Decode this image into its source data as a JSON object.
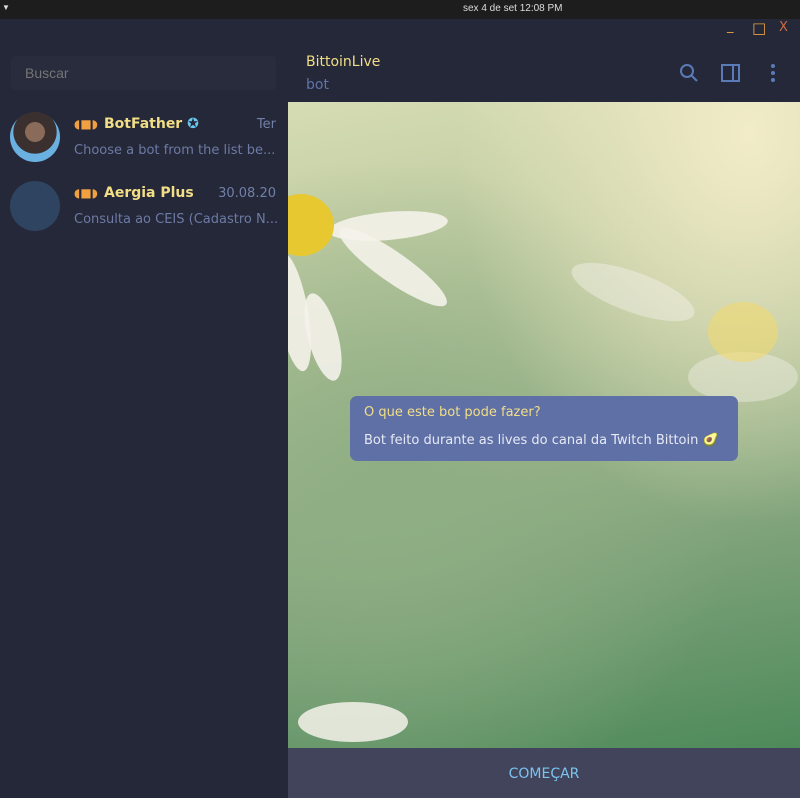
{
  "system_bar": {
    "clock": "sex 4 de set  12:08 PM"
  },
  "window_controls": {
    "minimize": "_",
    "maximize": "□",
    "close": "X"
  },
  "sidebar": {
    "search_placeholder": "Buscar",
    "chats": [
      {
        "name": "BotFather",
        "verified": true,
        "date": "Ter",
        "preview": "Choose a bot from the list be..."
      },
      {
        "name": "Aergia Plus",
        "verified": false,
        "date": "30.08.20",
        "preview": "Consulta ao CEIS (Cadastro N..."
      }
    ]
  },
  "header": {
    "title": "BittoinLive",
    "subtitle": "bot",
    "icons": [
      "search-icon",
      "sidebar-toggle-icon",
      "more-icon"
    ]
  },
  "message": {
    "title": "O que este bot pode fazer?",
    "text": "Bot feito durante as lives do canal da Twitch Bittoin",
    "emoji": "🥑"
  },
  "bottom": {
    "start_label": "COMEÇAR"
  }
}
